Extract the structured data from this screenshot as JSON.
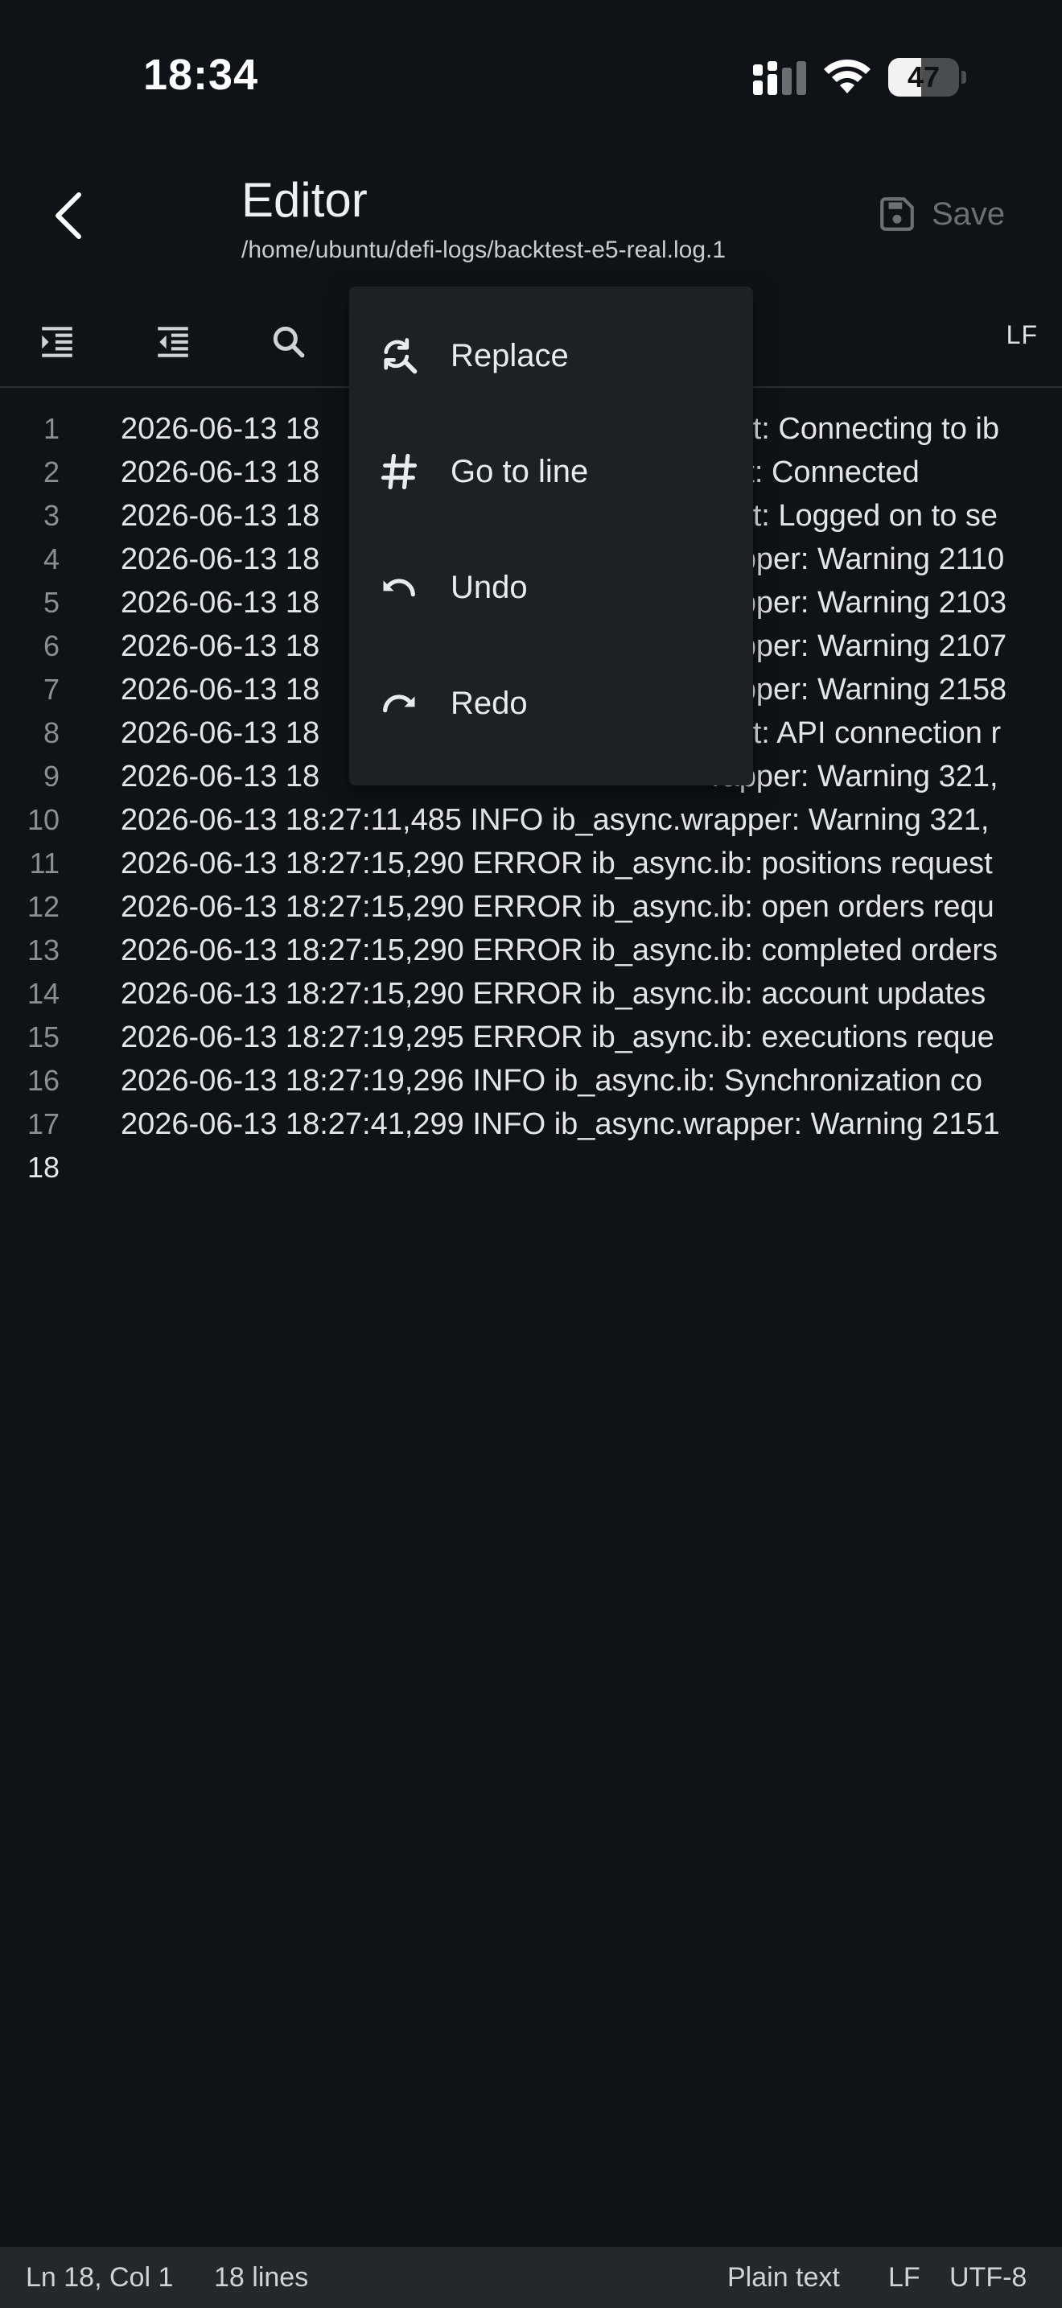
{
  "status_bar": {
    "time": "18:34",
    "battery_level": 47,
    "battery_text": "47"
  },
  "app_bar": {
    "title": "Editor",
    "path": "/home/ubuntu/defi-logs/backtest-e5-real.log.1",
    "save_label": "Save",
    "back_icon": "chevron-left-icon",
    "save_icon": "floppy-disk-icon"
  },
  "toolbar": {
    "line_ending": "LF"
  },
  "editor": {
    "lines": [
      {
        "n": "1",
        "text": "2026-06-13 18",
        "tail": "ient: Connecting to ib"
      },
      {
        "n": "2",
        "text": "2026-06-13 18",
        "tail": "ent: Connected"
      },
      {
        "n": "3",
        "text": "2026-06-13 18",
        "tail": "ient: Logged on to se"
      },
      {
        "n": "4",
        "text": "2026-06-13 18",
        "tail": "rapper: Warning 2110"
      },
      {
        "n": "5",
        "text": "2026-06-13 18",
        "tail": "rapper: Warning 2103"
      },
      {
        "n": "6",
        "text": "2026-06-13 18",
        "tail": "rapper: Warning 2107"
      },
      {
        "n": "7",
        "text": "2026-06-13 18",
        "tail": "rapper: Warning 2158"
      },
      {
        "n": "8",
        "text": "2026-06-13 18",
        "tail": "ient: API connection r"
      },
      {
        "n": "9",
        "text": "2026-06-13 18",
        "tail": "rapper: Warning 321,"
      },
      {
        "n": "10",
        "text": "2026-06-13 18:27:11,485 INFO ib_async.wrapper: Warning 321,",
        "tail": ""
      },
      {
        "n": "11",
        "text": "2026-06-13 18:27:15,290 ERROR ib_async.ib: positions request",
        "tail": ""
      },
      {
        "n": "12",
        "text": "2026-06-13 18:27:15,290 ERROR ib_async.ib: open orders requ",
        "tail": ""
      },
      {
        "n": "13",
        "text": "2026-06-13 18:27:15,290 ERROR ib_async.ib: completed orders",
        "tail": ""
      },
      {
        "n": "14",
        "text": "2026-06-13 18:27:15,290 ERROR ib_async.ib: account updates",
        "tail": ""
      },
      {
        "n": "15",
        "text": "2026-06-13 18:27:19,295 ERROR ib_async.ib: executions reque",
        "tail": ""
      },
      {
        "n": "16",
        "text": "2026-06-13 18:27:19,296 INFO ib_async.ib: Synchronization co",
        "tail": ""
      },
      {
        "n": "17",
        "text": "2026-06-13 18:27:41,299 INFO ib_async.wrapper: Warning 2151",
        "tail": ""
      },
      {
        "n": "18",
        "text": "",
        "tail": ""
      }
    ]
  },
  "menu": {
    "items": [
      {
        "label": "Replace",
        "icon": "find-replace-icon"
      },
      {
        "label": "Go to line",
        "icon": "hash-icon"
      },
      {
        "label": "Undo",
        "icon": "undo-icon"
      },
      {
        "label": "Redo",
        "icon": "redo-icon"
      }
    ]
  },
  "bottom_bar": {
    "position": "Ln 18, Col 1",
    "line_count": "18 lines",
    "language": "Plain text",
    "line_ending": "LF",
    "encoding": "UTF-8"
  },
  "colors": {
    "background": "#0f1317",
    "menu": "#1c2126",
    "status_bar": "#23282d"
  }
}
